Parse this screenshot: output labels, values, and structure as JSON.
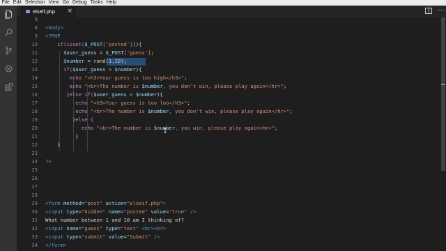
{
  "menubar": [
    "File",
    "Edit",
    "Selection",
    "View",
    "Go",
    "Debug",
    "Tasks",
    "Help"
  ],
  "activity_bar": [
    "files-icon",
    "search-icon",
    "source-control-icon",
    "debug-icon",
    "extensions-icon"
  ],
  "tab": {
    "label": "elseif.php",
    "close": "×"
  },
  "editor": {
    "lines": [
      {
        "n": "9",
        "tokens": []
      },
      {
        "n": "8",
        "tokens": [
          {
            "t": "<body>",
            "c": "#569cd6"
          }
        ]
      },
      {
        "n": "9",
        "tokens": [
          {
            "t": "<?PHP",
            "c": "#569cd6"
          }
        ]
      },
      {
        "n": "10",
        "tokens": [
          {
            "t": "    if(isset(",
            "c": "#c586c0"
          },
          {
            "t": "$_POST",
            "c": "#9cdcfe"
          },
          {
            "t": "['posted']",
            "c": "#ce9178"
          },
          {
            "t": ")){",
            "c": "#d4d4d4"
          }
        ]
      },
      {
        "n": "11",
        "tokens": [
          {
            "t": "      $user_guess",
            "c": "#9cdcfe"
          },
          {
            "t": " = ",
            "c": "#d4d4d4"
          },
          {
            "t": "$_POST",
            "c": "#9cdcfe"
          },
          {
            "t": "['guess']",
            "c": "#ce9178"
          },
          {
            "t": ";",
            "c": "#d4d4d4"
          }
        ]
      },
      {
        "n": "12",
        "tokens": [
          {
            "t": "      $number",
            "c": "#9cdcfe"
          },
          {
            "t": " = ",
            "c": "#d4d4d4"
          },
          {
            "t": "rand",
            "c": "#dcdcaa"
          },
          {
            "t": "(1,10);",
            "c": "#d4d4d4"
          }
        ]
      },
      {
        "n": "13",
        "tokens": [
          {
            "t": "      if(",
            "c": "#c586c0"
          },
          {
            "t": "$user_guess",
            "c": "#9cdcfe"
          },
          {
            "t": " > ",
            "c": "#d4d4d4"
          },
          {
            "t": "$number",
            "c": "#9cdcfe"
          },
          {
            "t": "){",
            "c": "#d4d4d4"
          }
        ]
      },
      {
        "n": "14",
        "tokens": [
          {
            "t": "        echo ",
            "c": "#c586c0"
          },
          {
            "t": "\"<h3>Your guess is too high</h3>\"",
            "c": "#ce9178"
          },
          {
            "t": ";",
            "c": "#d4d4d4"
          }
        ]
      },
      {
        "n": "15",
        "tokens": [
          {
            "t": "        echo ",
            "c": "#c586c0"
          },
          {
            "t": "\"<br>The number is ",
            "c": "#ce9178"
          },
          {
            "t": "$number",
            "c": "#9cdcfe"
          },
          {
            "t": ", you don't win, please play again</hr>\"",
            "c": "#ce9178"
          },
          {
            "t": ";",
            "c": "#d4d4d4"
          }
        ]
      },
      {
        "n": "16",
        "tokens": [
          {
            "t": "       }else if(",
            "c": "#c586c0"
          },
          {
            "t": "$user_guess",
            "c": "#9cdcfe"
          },
          {
            "t": " < ",
            "c": "#d4d4d4"
          },
          {
            "t": "$number",
            "c": "#9cdcfe"
          },
          {
            "t": "){",
            "c": "#d4d4d4"
          }
        ]
      },
      {
        "n": "17",
        "tokens": [
          {
            "t": "          echo ",
            "c": "#c586c0"
          },
          {
            "t": "\"<h3>Your guess is too loo</h3>\"",
            "c": "#ce9178"
          },
          {
            "t": ";",
            "c": "#d4d4d4"
          }
        ]
      },
      {
        "n": "18",
        "tokens": [
          {
            "t": "          echo ",
            "c": "#c586c0"
          },
          {
            "t": "\"<br>The number is ",
            "c": "#ce9178"
          },
          {
            "t": "$number",
            "c": "#9cdcfe"
          },
          {
            "t": ", you don't win, please play again</hr>\"",
            "c": "#ce9178"
          },
          {
            "t": ";",
            "c": "#d4d4d4"
          }
        ]
      },
      {
        "n": "19",
        "tokens": [
          {
            "t": "         }else {",
            "c": "#c586c0"
          }
        ]
      },
      {
        "n": "20",
        "tokens": [
          {
            "t": "            echo ",
            "c": "#c586c0"
          },
          {
            "t": "\"<br>The number is ",
            "c": "#ce9178"
          },
          {
            "t": "$number",
            "c": "#9cdcfe"
          },
          {
            "t": ", you win, please play again<hr>\"",
            "c": "#ce9178"
          },
          {
            "t": ";",
            "c": "#d4d4d4"
          }
        ]
      },
      {
        "n": "21",
        "tokens": [
          {
            "t": "          }",
            "c": "#d4d4d4"
          }
        ]
      },
      {
        "n": "22",
        "tokens": [
          {
            "t": "    }",
            "c": "#d4d4d4"
          }
        ]
      },
      {
        "n": "23",
        "tokens": []
      },
      {
        "n": "24",
        "tokens": [
          {
            "t": "?>",
            "c": "#569cd6"
          }
        ]
      },
      {
        "n": "25",
        "tokens": []
      },
      {
        "n": "26",
        "tokens": []
      },
      {
        "n": "27",
        "tokens": []
      },
      {
        "n": "28",
        "tokens": []
      },
      {
        "n": "29",
        "tokens": [
          {
            "t": "<form ",
            "c": "#569cd6"
          },
          {
            "t": "method=",
            "c": "#9cdcfe"
          },
          {
            "t": "\"post\"",
            "c": "#ce9178"
          },
          {
            "t": " action=",
            "c": "#9cdcfe"
          },
          {
            "t": "\"elseif.php\"",
            "c": "#ce9178"
          },
          {
            "t": ">",
            "c": "#569cd6"
          }
        ]
      },
      {
        "n": "30",
        "tokens": [
          {
            "t": "<input ",
            "c": "#569cd6"
          },
          {
            "t": "type=",
            "c": "#9cdcfe"
          },
          {
            "t": "\"hidden\"",
            "c": "#ce9178"
          },
          {
            "t": " name=",
            "c": "#9cdcfe"
          },
          {
            "t": "\"posted\"",
            "c": "#ce9178"
          },
          {
            "t": " value=",
            "c": "#9cdcfe"
          },
          {
            "t": "\"true\"",
            "c": "#ce9178"
          },
          {
            "t": " />",
            "c": "#569cd6"
          }
        ]
      },
      {
        "n": "31",
        "tokens": [
          {
            "t": "What number between 1 and 10 am I thinking of?",
            "c": "#d4d4d4"
          }
        ]
      },
      {
        "n": "32",
        "tokens": [
          {
            "t": "<input ",
            "c": "#569cd6"
          },
          {
            "t": "name=",
            "c": "#9cdcfe"
          },
          {
            "t": "\"guess\"",
            "c": "#ce9178"
          },
          {
            "t": " type=",
            "c": "#9cdcfe"
          },
          {
            "t": "\"text\"",
            "c": "#ce9178"
          },
          {
            "t": " <br><br>",
            "c": "#569cd6"
          }
        ]
      },
      {
        "n": "33",
        "tokens": [
          {
            "t": "<input ",
            "c": "#569cd6"
          },
          {
            "t": "type=",
            "c": "#9cdcfe"
          },
          {
            "t": "\"submit\"",
            "c": "#ce9178"
          },
          {
            "t": " value=",
            "c": "#9cdcfe"
          },
          {
            "t": "\"Submit\"",
            "c": "#ce9178"
          },
          {
            "t": " />",
            "c": "#569cd6"
          }
        ]
      },
      {
        "n": "34",
        "tokens": [
          {
            "t": "</form>",
            "c": "#569cd6"
          }
        ]
      }
    ]
  },
  "selection_text": "rand(1,10);",
  "colors": {
    "keyword": "#c586c0",
    "variable": "#9cdcfe",
    "string": "#ce9178",
    "tag": "#569cd6",
    "function": "#dcdcaa",
    "plain": "#d4d4d4"
  }
}
